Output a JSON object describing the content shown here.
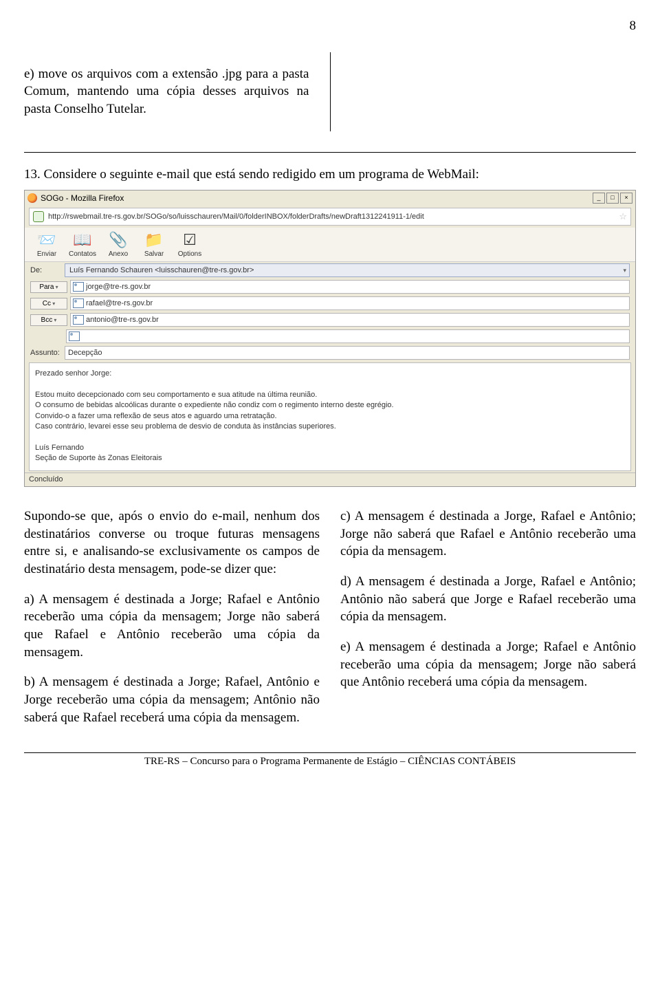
{
  "page_number": "8",
  "intro_option_e": "e) move os arquivos com a extensão .jpg para a pasta Comum, mantendo uma cópia desses arquivos na pasta Conselho Tutelar.",
  "q13_prompt": "13. Considere o seguinte e-mail que está sendo redigido em um programa de WebMail:",
  "window": {
    "title": "SOGo - Mozilla Firefox",
    "url": "http://rswebmail.tre-rs.gov.br/SOGo/so/luisschauren/Mail/0/folderINBOX/folderDrafts/newDraft1312241911-1/edit"
  },
  "toolbar": {
    "enviar": "Enviar",
    "contatos": "Contatos",
    "anexo": "Anexo",
    "salvar": "Salvar",
    "options": "Options"
  },
  "fields": {
    "de_label": "De:",
    "de_value": "Luís Fernando Schauren <luisschauren@tre-rs.gov.br>",
    "para_label": "Para",
    "para_value": "jorge@tre-rs.gov.br",
    "cc_label": "Cc",
    "cc_value": "rafael@tre-rs.gov.br",
    "bcc_label": "Bcc",
    "bcc_value": "antonio@tre-rs.gov.br",
    "assunto_label": "Assunto:",
    "assunto_value": "Decepção"
  },
  "body": {
    "greeting": "Prezado senhor Jorge:",
    "l1": "Estou muito decepcionado com seu comportamento e sua atitude na última reunião.",
    "l2": "O consumo de bebidas alcoólicas durante o expediente não condiz com o regimento interno deste egrégio.",
    "l3": "Convido-o a fazer uma reflexão de seus atos e aguardo uma retratação.",
    "l4": "Caso contrário, levarei esse seu problema de desvio de conduta às instâncias superiores.",
    "sign1": "Luís Fernando",
    "sign2": "Seção de Suporte às Zonas Eleitorais"
  },
  "status": "Concluído",
  "after_text": {
    "p1": "Supondo-se que, após o envio do e-mail, nenhum dos destinatários converse ou troque futuras mensagens entre si, e analisando-se exclusivamente os campos de destinatário desta mensagem, pode-se dizer que:",
    "a": "a) A mensagem é destinada a Jorge; Rafael e Antônio receberão uma cópia da mensagem; Jorge não saberá que Rafael e Antônio receberão uma cópia da mensagem.",
    "b": "b) A mensagem é destinada a Jorge; Rafael, Antônio e Jorge receberão uma cópia da mensagem; Antônio não saberá que Rafael receberá uma cópia da mensagem.",
    "c": "c) A mensagem é destinada a Jorge, Rafael e Antônio; Jorge não saberá que Rafael e Antônio receberão uma cópia da mensagem.",
    "d": "d) A mensagem é destinada a Jorge, Rafael e Antônio; Antônio não saberá que Jorge e Rafael receberão uma cópia da mensagem.",
    "e": "e) A mensagem é destinada a Jorge; Rafael e Antônio receberão uma cópia da mensagem; Jorge não saberá que Antônio receberá uma cópia da mensagem."
  },
  "footer": "TRE-RS – Concurso para o Programa Permanente de Estágio – CIÊNCIAS CONTÁBEIS"
}
